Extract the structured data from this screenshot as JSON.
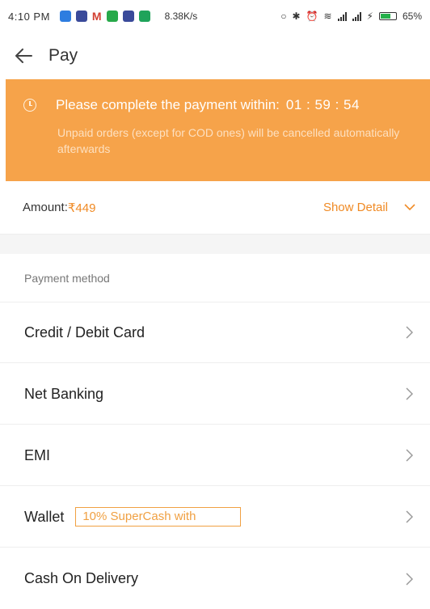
{
  "status_bar": {
    "time": "4:10 PM",
    "network_speed": "8.38K/s",
    "battery_percent": "65%"
  },
  "app_bar": {
    "title": "Pay",
    "back_icon": "arrow-left-icon"
  },
  "banner": {
    "message": "Please complete the payment within:",
    "timer": "01 : 59 : 54",
    "note": "Unpaid orders (except for COD ones) will be cancelled automatically afterwards",
    "icon": "clock-icon",
    "background_color": "#f6a34a"
  },
  "amount": {
    "label": "Amount:",
    "value": "₹449",
    "show_detail": "Show Detail",
    "accent_color": "#f08a24"
  },
  "payment": {
    "section_title": "Payment method",
    "methods": [
      {
        "label": "Credit / Debit Card"
      },
      {
        "label": "Net Banking"
      },
      {
        "label": "EMI"
      },
      {
        "label": "Wallet",
        "badge": "10% SuperCash with"
      },
      {
        "label": "Cash On Delivery"
      }
    ]
  }
}
